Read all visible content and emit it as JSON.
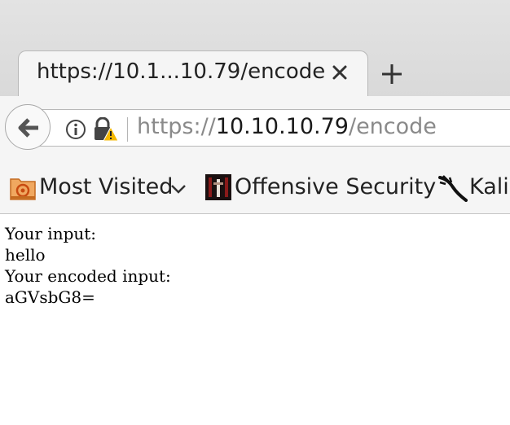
{
  "tab": {
    "title": "https://10.1...10.79/encode",
    "close_icon": "close-icon",
    "new_tab_icon": "plus-icon"
  },
  "nav": {
    "url_scheme": "https://",
    "url_host": "10.10.10.79",
    "url_path": "/encode",
    "back_icon": "back-arrow-icon",
    "info_icon": "info-icon",
    "lock_icon": "lock-warning-icon"
  },
  "bookmarks": [
    {
      "label": "Most Visited",
      "icon": "most-visited-folder-icon"
    },
    {
      "label": "Offensive Security",
      "icon": "offensive-security-icon"
    },
    {
      "label": "Kali",
      "icon": "kali-dragon-icon"
    }
  ],
  "page": {
    "lines": [
      "Your input:",
      "hello",
      "Your encoded input:",
      "aGVsbG8="
    ]
  },
  "colors": {
    "chrome_bg": "#f5f5f5",
    "tabstrip_bg": "#dedede",
    "url_dim": "#8a8a8a",
    "warning": "#f5b800"
  }
}
